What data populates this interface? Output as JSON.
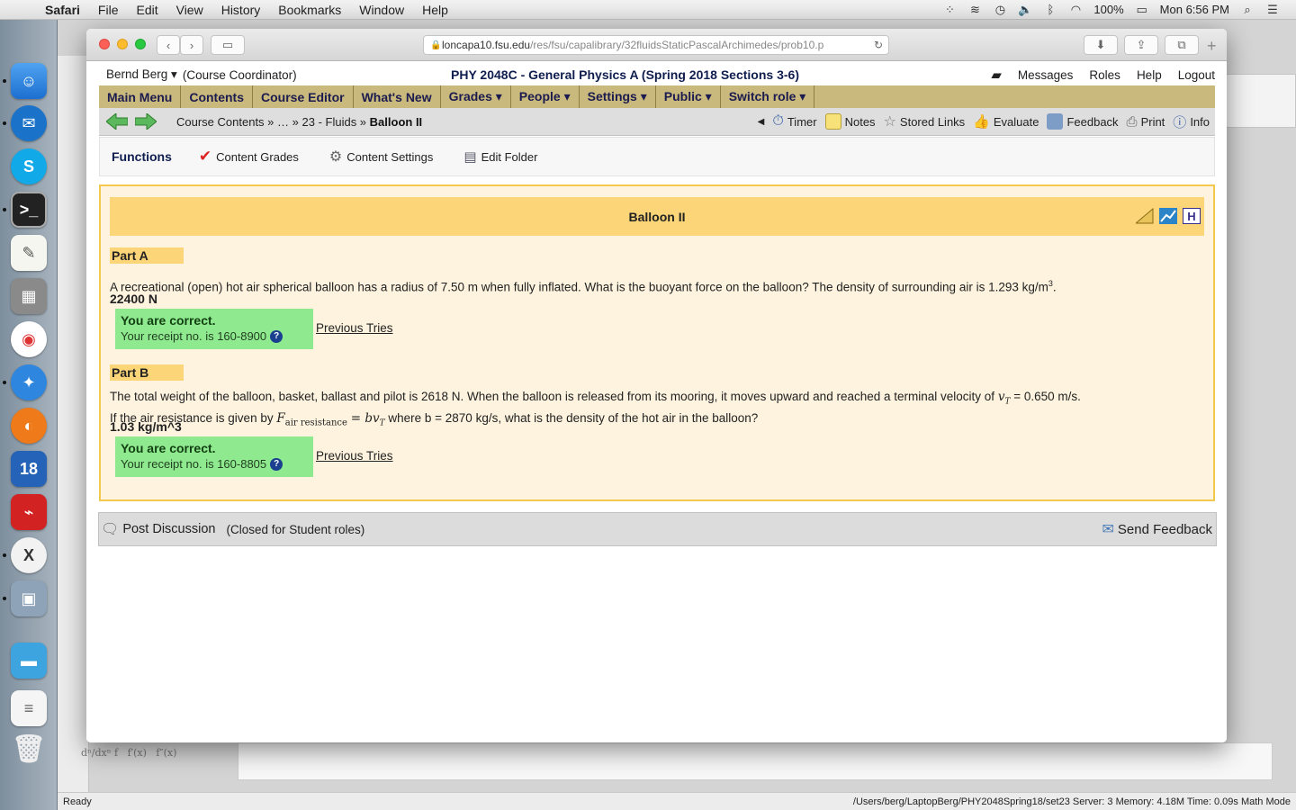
{
  "menubar": {
    "app": "Safari",
    "items": [
      "File",
      "Edit",
      "View",
      "History",
      "Bookmarks",
      "Window",
      "Help"
    ],
    "battery": "100%",
    "clock": "Mon 6:56 PM"
  },
  "browser": {
    "url_host": "loncapa10.fsu.edu",
    "url_path": "/res/fsu/capalibrary/32fluidsStaticPascalArchimedes/prob10.p"
  },
  "header": {
    "user": "Bernd Berg ▾",
    "role": "(Course Coordinator)",
    "course": "PHY 2048C - General Physics A (Spring 2018 Sections 3-6)",
    "links": [
      "Messages",
      "Roles",
      "Help",
      "Logout"
    ]
  },
  "mainmenu": [
    "Main Menu",
    "Contents",
    "Course Editor",
    "What's New",
    "Grades ▾",
    "People ▾",
    "Settings ▾",
    "Public ▾",
    "Switch role ▾"
  ],
  "navbar": {
    "crumb1": "Course Contents »",
    "crumb2": "… »",
    "crumb3": "23 - Fluids »",
    "crumb4": "Balloon II",
    "tools": [
      "Timer",
      "Notes",
      "Stored Links",
      "Evaluate",
      "Feedback",
      "Print",
      "Info"
    ]
  },
  "functions": {
    "title": "Functions",
    "items": [
      "Content Grades",
      "Content Settings",
      "Edit Folder"
    ]
  },
  "problem": {
    "title": "Balloon II",
    "partA": {
      "label": "Part A",
      "question": "A recreational (open) hot air spherical balloon has a radius of 7.50 m when fully inflated. What is the buoyant force on the balloon? The density of surrounding air is 1.293 kg/m",
      "sup": "3",
      "period": ".",
      "answer": "22400 N",
      "status": "You are correct.",
      "receipt": "Your receipt no. is 160-8900",
      "prev": "Previous Tries"
    },
    "partB": {
      "label": "Part B",
      "q1": "The total weight of the balloon, basket, ballast and pilot is 2618 N. When the balloon is released from its mooring, it moves upward and reached a terminal velocity of",
      "vt": "v",
      "vt_sub": "T",
      "q1_end": "= 0.650 m/s.",
      "q2_start": "If the air resistance is given by",
      "F": "F",
      "F_sub": "air resistance",
      "eq": "= bv",
      "eq_sub": "T",
      "q2_end": "where b = 2870 kg/s, what is the density of the hot air in the balloon?",
      "answer": "1.03 kg/m^3",
      "status": "You are correct.",
      "receipt": "Your receipt no. is 160-8805",
      "prev": "Previous Tries"
    }
  },
  "discussion": {
    "post": "Post Discussion",
    "closed": "(Closed for Student roles)",
    "send": "Send Feedback"
  },
  "statusbar": {
    "left": "Ready",
    "right": "/Users/berg/LaptopBerg/PHY2048Spring18/set23   Server: 3   Memory: 4.18M   Time: 0.09s   Math Mode"
  },
  "colors": {
    "menu_bar": "#c9b97c",
    "problem_bg": "#fdf3de",
    "problem_border": "#f3c84f",
    "title_bg": "#fbd577",
    "correct_bg": "#8fe98f"
  }
}
